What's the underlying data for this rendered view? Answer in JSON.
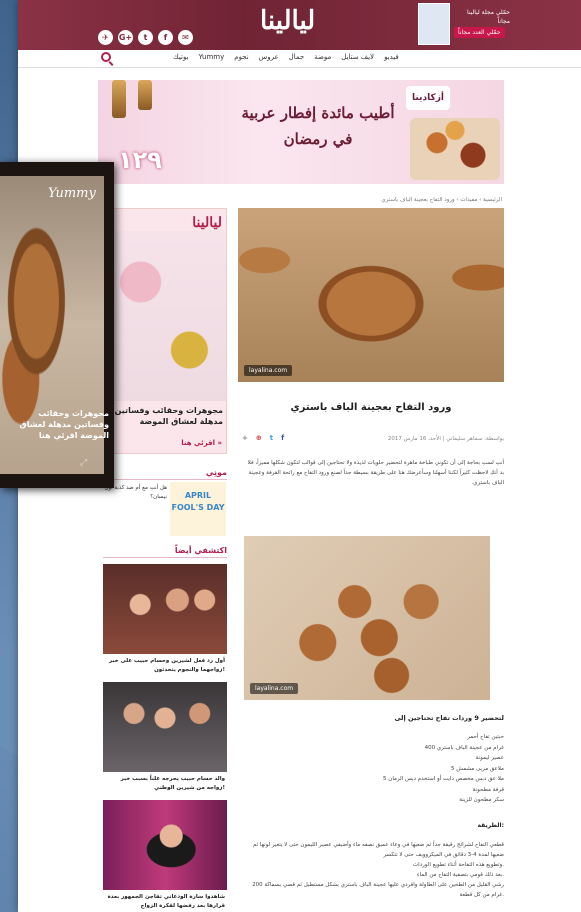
{
  "header": {
    "logo": "ليالينا",
    "social": [
      "✈",
      "G+",
      "t",
      "f",
      "✉"
    ],
    "magazine_text": "حمّلي مجلة ليالينا مجاناً",
    "magazine_button": "حمّلي العدد مجاناً"
  },
  "nav": {
    "items": [
      "فيديو",
      "لايف ستايل",
      "موضة",
      "جمال",
      "عروس",
      "نجوم",
      "Yummy",
      "بوتيك"
    ]
  },
  "banner": {
    "price": "١٢٩",
    "headline": "أطيب مائدة إفطار عربية في رمضان",
    "brand": "أزكادينا"
  },
  "article": {
    "breadcrumb": "الرئيسية › مفيدات › ورود التفاح بعجينة الباف باستري",
    "watermark": "layalina.com",
    "title": "ورود التفاح بعجينة الباف باستري",
    "meta": "بواسطة: سماهر سليماني | الأحد، 16 مارس 2017",
    "share": [
      "+",
      "⊕",
      "t",
      "f"
    ],
    "intro": "أنتِ لستِ بحاجة إلى أن تكوني طباخة ماهرة لتحضير حلويات لذيذة ولا تحتاجين إلى قوالب لتكون شكلها مميزاً، فلا بد أنكِ لاحظت كثيراً لكننا أسهلنا وسأعرضك هنا على طريقة بسيطة جداً لصنع ورود التفاح مع رائحة القرفة وعجينة الباف باستري.",
    "image2_watermark": "layalina.com",
    "subtitle": "لتحضير 9 وردات تفاح تحتاجين إلى",
    "ingredients": [
      "حبتين تفاح أحمر",
      "400 غرام من عجينة الباف باستري",
      "عصير ليمونة",
      "5 ملاعق مربى مشمش",
      "5 ملا عق دبس مخصص دايت أو استخدم دبس الرمان",
      "قرفة مطحونة",
      "سكر مطحون للزينة"
    ],
    "steps_label": "الطريقة:",
    "steps": [
      "قطعي التفاح لشرائح رقيقة جداً ثم ضعيها في وعاء عميق نصفه ماء وأضيفي عصير الليمون حتى لا يتغير لونها ثم ضعيها لمدة 4-3 دقائق في الميكروويف حتى لا تتكسر",
      "وتطويع هذه التفاحة أثناء تطويع الوردات.",
      "بعد ذلك قومي بتصفية التفاح من الماء.",
      "رشي القليل من الطحين على الطاولة وافردي عليها عجينة الباف باستري بشكل مستطيل ثم قصي بسماكة 200 غرام من كل قطعة."
    ]
  },
  "sidebar": {
    "ad_logo": "ليالينا",
    "ad_title": "مجوهرات وحقائب وفساتين مدهلة لعشاق الموضة",
    "ad_button": "اقرئي هنا »",
    "section1": "مونِي",
    "april_text": "APRIL FOOL'S DAY",
    "section1_text": "هل أنتِ مع أم ضد كذبة أول نيسان؟",
    "section2": "اكتشفي أيضاً",
    "cards": [
      "أول رد فعل لشيرين وحسام حبيب على خبر زواجهما والنجوم يتحدثون!",
      "والد حسام حبيب يحرجه علناً بسبب خبر زواجه من شيرين الوطني!",
      "شاهدوا سارة الودعاني تفاجئ الجمهور بعدة قرارها بعد رفضها لفكرة الزواج"
    ]
  },
  "overlay": {
    "logo": "Yummy",
    "text": "مجوهرات وحقائب وفساتين مدهلة لعشاق الموضة اقرئي هنا"
  }
}
